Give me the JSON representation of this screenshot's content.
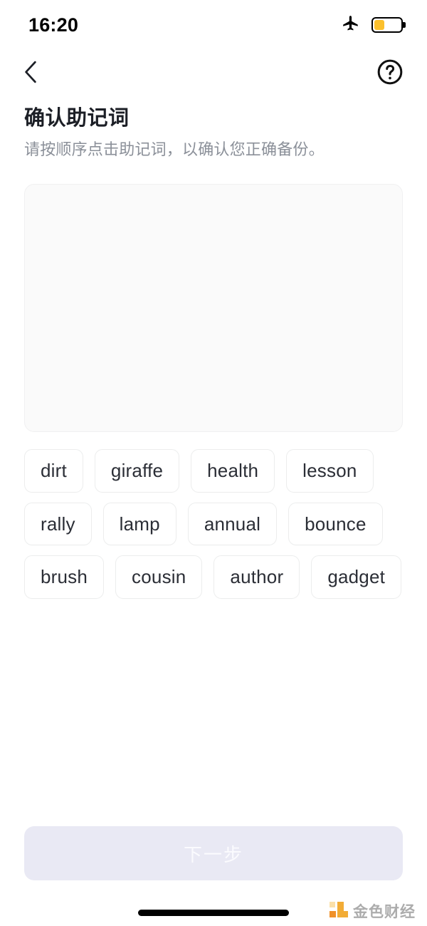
{
  "status_bar": {
    "time": "16:20",
    "airplane_icon": "airplane-mode-icon",
    "battery_icon": "battery-low-power-icon",
    "battery_level_percent": 40,
    "battery_fill_color": "#fbc02d"
  },
  "nav_bar": {
    "back_icon": "chevron-left-icon",
    "help_icon": "question-circle-icon"
  },
  "heading": {
    "title": "确认助记词",
    "subtitle": "请按顺序点击助记词，以确认您正确备份。"
  },
  "answer_area": {
    "selected_words": [],
    "placeholder": ""
  },
  "word_bank": {
    "words": [
      "dirt",
      "giraffe",
      "health",
      "lesson",
      "rally",
      "lamp",
      "annual",
      "bounce",
      "brush",
      "cousin",
      "author",
      "gadget"
    ]
  },
  "footer": {
    "next_label": "下一步",
    "next_disabled": true,
    "next_bg_color": "#e9e9f4",
    "next_text_color": "#fbfbfe"
  },
  "home_indicator": {
    "label": "home-indicator"
  },
  "watermark": {
    "text": "金色财经",
    "logo_color": "#f2a82c"
  }
}
